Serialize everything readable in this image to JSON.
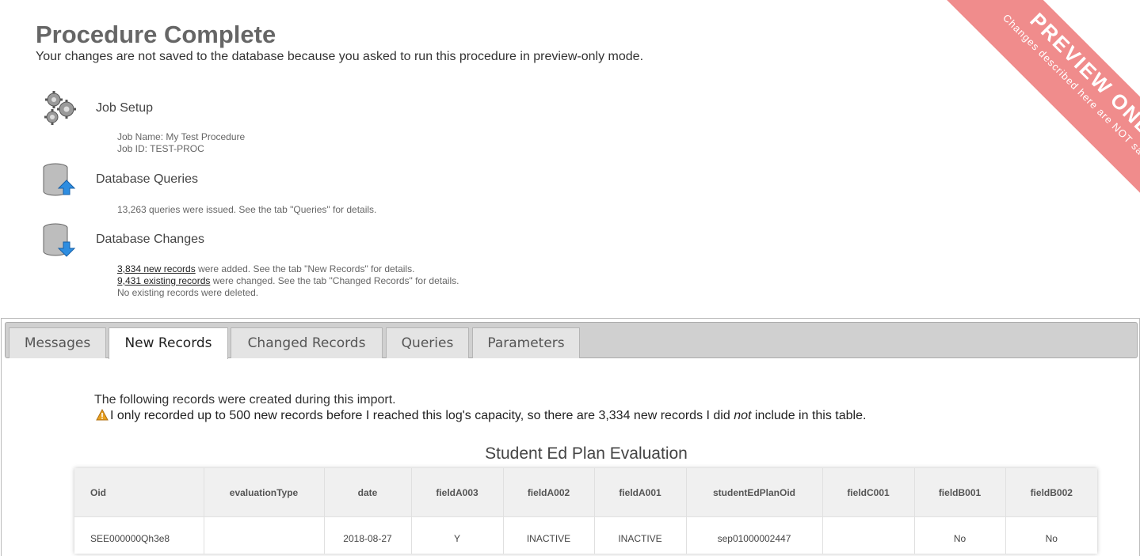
{
  "ribbon": {
    "title": "PREVIEW ONLY",
    "subtitle": "Changes described here are NOT saved."
  },
  "header": {
    "title": "Procedure Complete",
    "subtitle": "Your changes are not saved to the database because you asked to run this procedure in preview-only mode."
  },
  "sections": {
    "job_setup": {
      "title": "Job Setup",
      "icon": "gears-icon",
      "job_name": "Job Name: My Test Procedure",
      "job_id": "Job ID: TEST-PROC"
    },
    "queries": {
      "title": "Database Queries",
      "icon": "database-upload-icon",
      "detail": "13,263 queries were issued. See the tab \"Queries\" for details."
    },
    "changes": {
      "title": "Database Changes",
      "icon": "database-download-icon",
      "new_link": "3,834 new records",
      "new_rest": " were added. See the tab \"New Records\" for details.",
      "changed_link": "9,431 existing records",
      "changed_rest": " were changed. See the tab \"Changed Records\" for details.",
      "deleted": "No existing records were deleted."
    }
  },
  "tabs": [
    "Messages",
    "New Records",
    "Changed Records",
    "Queries",
    "Parameters"
  ],
  "active_tab": "New Records",
  "content": {
    "intro": "The following records were created during this import.",
    "warning_pre": "I only recorded up to 500 new records before I reached this log's capacity, so there are 3,334 new records I did ",
    "warning_em": "not",
    "warning_post": " include in this table."
  },
  "table": {
    "title": "Student Ed Plan Evaluation",
    "columns": [
      "Oid",
      "evaluationType",
      "date",
      "fieldA003",
      "fieldA002",
      "fieldA001",
      "studentEdPlanOid",
      "fieldC001",
      "fieldB001",
      "fieldB002"
    ],
    "rows": [
      [
        "SEE000000Qh3e8",
        "",
        "2018-08-27",
        "Y",
        "INACTIVE",
        "INACTIVE",
        "sep01000002447",
        "",
        "No",
        "No"
      ]
    ]
  },
  "colors": {
    "ribbon": "#f08c8c",
    "warning": "#e8a020"
  }
}
